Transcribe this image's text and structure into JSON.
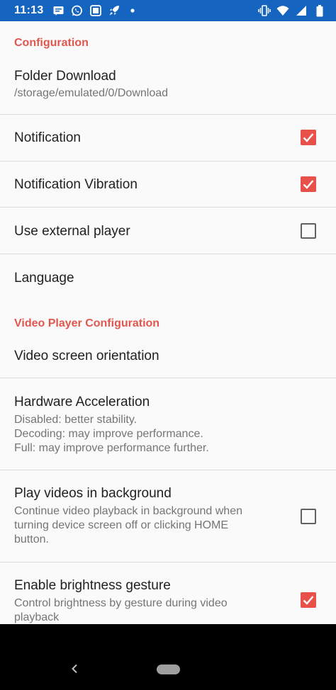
{
  "status_bar": {
    "time": "11:13",
    "left_icons": [
      "message-icon",
      "whatsapp-icon",
      "screenshot-icon",
      "rocket-icon",
      "dot-icon"
    ],
    "right_icons": [
      "vibrate-icon",
      "wifi-icon",
      "signal-icon",
      "battery-icon"
    ],
    "color": "#1565c0"
  },
  "categories": {
    "configuration": "Configuration",
    "video_player": "Video Player Configuration"
  },
  "prefs": {
    "folder_download": {
      "title": "Folder Download",
      "summary": "/storage/emulated/0/Download"
    },
    "notification": {
      "title": "Notification",
      "checked": true
    },
    "notification_vibration": {
      "title": "Notification Vibration",
      "checked": true
    },
    "use_external_player": {
      "title": "Use external player",
      "checked": false
    },
    "language": {
      "title": "Language"
    },
    "video_screen_orientation": {
      "title": "Video screen orientation"
    },
    "hardware_acceleration": {
      "title": "Hardware Acceleration",
      "summary_lines": [
        "Disabled: better stability.",
        "Decoding: may improve performance.",
        "Full: may improve performance further."
      ]
    },
    "play_in_background": {
      "title": "Play videos in background",
      "summary_lines": [
        "Continue video playback in background when",
        "turning device screen off or clicking HOME",
        "button."
      ],
      "checked": false
    },
    "brightness_gesture": {
      "title": "Enable brightness gesture",
      "summary_lines": [
        "Control brightness by gesture during video",
        "playback"
      ],
      "checked": true
    }
  },
  "colors": {
    "accent": "#e8514a",
    "category": "#e0574f",
    "background": "#fafafa"
  },
  "nav_bar": {
    "icons": [
      "back-icon",
      "home-pill-icon"
    ]
  }
}
